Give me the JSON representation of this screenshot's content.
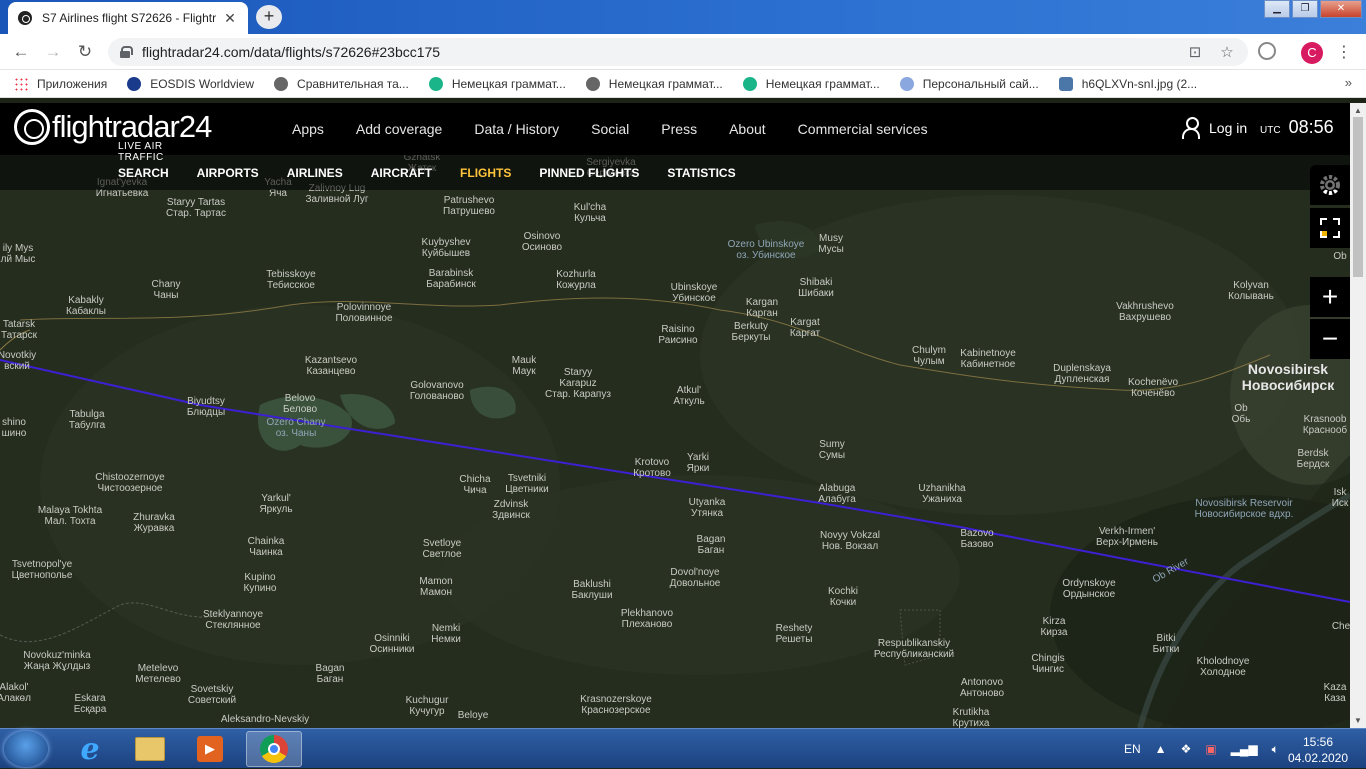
{
  "browser": {
    "tab_title": "S7 Airlines flight S72626 - Flightr",
    "url": "flightradar24.com/data/flights/s72626#23bcc175",
    "bookmarks": [
      {
        "label": "Приложения"
      },
      {
        "label": "EOSDIS Worldview"
      },
      {
        "label": "Сравнительная та..."
      },
      {
        "label": "Немецкая граммат..."
      },
      {
        "label": "Немецкая граммат..."
      },
      {
        "label": "Немецкая граммат..."
      },
      {
        "label": "Персональный сай..."
      },
      {
        "label": "h6QLXVn-snI.jpg (2..."
      }
    ],
    "profile_initial": "C"
  },
  "header": {
    "logo_text": "flightradar24",
    "logo_tagline": "LIVE AIR TRAFFIC",
    "nav": [
      "Apps",
      "Add coverage",
      "Data / History",
      "Social",
      "Press",
      "About",
      "Commercial services"
    ],
    "login": "Log in",
    "utc_label": "UTC",
    "time": "08:56"
  },
  "subnav": [
    "SEARCH",
    "AIRPORTS",
    "AIRLINES",
    "AIRCRAFT",
    "FLIGHTS",
    "PINNED FLIGHTS",
    "STATISTICS"
  ],
  "subnav_active": "FLIGHTS",
  "map": {
    "flight_path_color": "#3d1fd4",
    "labels": [
      {
        "text": "Ignat'yevka\nИгнатьевка"
      },
      {
        "text": "Staryy Tartas\nСтар. Тартас"
      },
      {
        "text": "Yacha\nЯча"
      },
      {
        "text": "Zalivnoy Lug\nЗаливной Луг"
      },
      {
        "text": "Patrushevo\nПатрушево"
      },
      {
        "text": "Kul'cha\nКульча"
      },
      {
        "text": "Gzhatsk\nЖатск"
      },
      {
        "text": "Sergiyevka\nСергиевка"
      },
      {
        "text": "Osinovo\nОсиново"
      },
      {
        "text": "Kuybyshev\nКуйбышев"
      },
      {
        "text": "Barabinsk\nБарабинск"
      },
      {
        "text": "Kozhurla\nКожурла"
      },
      {
        "text": "Ozero Ubinskoye\nоз. Убинское"
      },
      {
        "text": "Musy\nМусы"
      },
      {
        "text": "Shibaki\nШибаки"
      },
      {
        "text": "Ubinskoye\nУбинское"
      },
      {
        "text": "Kargan\nКарган"
      },
      {
        "text": "Kargat\nКаргат"
      },
      {
        "text": "Berkuty\nБеркуты"
      },
      {
        "text": "Raisino\nРаисино"
      },
      {
        "text": "Tebisskoye\nТебисское"
      },
      {
        "text": "Chany\nЧаны"
      },
      {
        "text": "Kabakly\nКабаклы"
      },
      {
        "text": "Tatarsk\nТатарск"
      },
      {
        "text": "Polovinnoye\nПоловинное"
      },
      {
        "text": "ily Mys\nлй Мыс"
      },
      {
        "text": "Kazantsevo\nКазанцево"
      },
      {
        "text": "Mauk\nМаук"
      },
      {
        "text": "Staryy\nKarapuz\nСтар. Карапуз"
      },
      {
        "text": "Atkul'\nАткуль"
      },
      {
        "text": "Golovanovo\nГолованово"
      },
      {
        "text": "Belovo\nБелово"
      },
      {
        "text": "Biyudtsy\nБлюдцы"
      },
      {
        "text": "Tabulga\nТабулга"
      },
      {
        "text": "Ozero Chany\nоз. Чаны"
      },
      {
        "text": "shino\nшино"
      },
      {
        "text": "Chulym\nЧулым"
      },
      {
        "text": "Kabinetnoye\nКабинетное"
      },
      {
        "text": "Duplenskaya\nДупленская"
      },
      {
        "text": "Kochenëvo\nКоченёво"
      },
      {
        "text": "Novosibirsk\nНовосибирск"
      },
      {
        "text": "Vakhrushevo\nВахрушево"
      },
      {
        "text": "Kolyvan\nКолывань"
      },
      {
        "text": "Ob\nОбь"
      },
      {
        "text": "Krasnoob\nКраснооб"
      },
      {
        "text": "Berdsk\nБердск"
      },
      {
        "text": "Novosibirsk Reservoir\nНовосибирское вдхр."
      },
      {
        "text": "Sumy\nСумы"
      },
      {
        "text": "Krotovo\nКротово"
      },
      {
        "text": "Yarki\nЯрки"
      },
      {
        "text": "Alabuga\nАлабуга"
      },
      {
        "text": "Uzhanikha\nУжаниха"
      },
      {
        "text": "Chistoozernoye\nЧистоозерное"
      },
      {
        "text": "Chicha\nЧича"
      },
      {
        "text": "Tsvetniki\nЦветники"
      },
      {
        "text": "Zdvinsk\nЗдвинск"
      },
      {
        "text": "Utyanka\nУтянка"
      },
      {
        "text": "Malaya Tokhta\nМал. Тохта"
      },
      {
        "text": "Zhuravka\nЖуравка"
      },
      {
        "text": "Yarkul'\nЯркуль"
      },
      {
        "text": "Bazovo\nБазово"
      },
      {
        "text": "Novyy Vokzal\nНов. Вокзал"
      },
      {
        "text": "Verkh-Irmen'\nВерх-Ирмень"
      },
      {
        "text": "Chainka\nЧаинка"
      },
      {
        "text": "Svetloye\nСветлое"
      },
      {
        "text": "Bagan\nБаган"
      },
      {
        "text": "Tsvetnopol'ye\nЦветнополье"
      },
      {
        "text": "Dovol'noye\nДовольное"
      },
      {
        "text": "Ob River"
      },
      {
        "text": "Ordynskoye\nОрдынское"
      },
      {
        "text": "Kupino\nКупино"
      },
      {
        "text": "Mamon\nМамон"
      },
      {
        "text": "Baklushi\nБаклуши"
      },
      {
        "text": "Kochki\nКочки"
      },
      {
        "text": "Steklyannoye\nСтеклянное"
      },
      {
        "text": "Plekhanovo\nПлеханово"
      },
      {
        "text": "Kirza\nКирза"
      },
      {
        "text": "Reshety\nРешеты"
      },
      {
        "text": "Osinniki\nОсинники"
      },
      {
        "text": "Nemki\nНемки"
      },
      {
        "text": "Bitki\nБитки"
      },
      {
        "text": "Respublikanskiy\nРеспубликанский"
      },
      {
        "text": "Novokuz'minka\nЖаңа Жұлдыз"
      },
      {
        "text": "Chingis\nЧингис"
      },
      {
        "text": "Kholodnoye\nХолодное"
      },
      {
        "text": "Metelevo\nМетелево"
      },
      {
        "text": "Bagan\nБаган"
      },
      {
        "text": "Antonovo\nАнтоново"
      },
      {
        "text": "Sovetskiy\nСоветский"
      },
      {
        "text": "Krasnozerskoye\nКраснозерское"
      },
      {
        "text": "Alakol'\nАлакөл"
      },
      {
        "text": "Eskara\nЕсқара"
      },
      {
        "text": "Kuchugur\nКучугур"
      },
      {
        "text": "Krutikha\nКрутиха"
      },
      {
        "text": "Aleksandro-Nevskiy"
      },
      {
        "text": "Beloye"
      },
      {
        "text": "Isk\nИск"
      },
      {
        "text": "Che"
      },
      {
        "text": "Kazа\nКаза"
      },
      {
        "text": "Novotkiy\nвский"
      },
      {
        "text": "Ob"
      }
    ]
  },
  "taskbar": {
    "lang": "EN",
    "time": "15:56",
    "date": "04.02.2020"
  }
}
